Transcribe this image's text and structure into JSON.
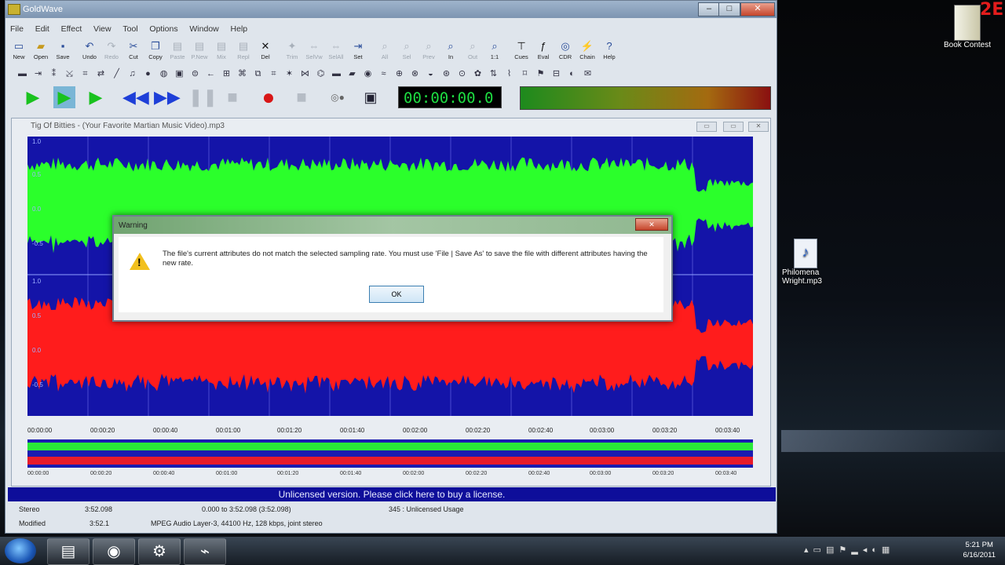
{
  "app": {
    "title": "GoldWave"
  },
  "menu": [
    "File",
    "Edit",
    "Effect",
    "View",
    "Tool",
    "Options",
    "Window",
    "Help"
  ],
  "toolbar1": [
    {
      "label": "New",
      "icon": "new-file-icon",
      "enabled": true
    },
    {
      "label": "Open",
      "icon": "open-folder-icon",
      "enabled": true
    },
    {
      "label": "Save",
      "icon": "save-icon",
      "enabled": true
    },
    {
      "label": "Undo",
      "icon": "undo-icon",
      "enabled": true
    },
    {
      "label": "Redo",
      "icon": "redo-icon",
      "enabled": false
    },
    {
      "label": "Cut",
      "icon": "cut-icon",
      "enabled": true
    },
    {
      "label": "Copy",
      "icon": "copy-icon",
      "enabled": true
    },
    {
      "label": "Paste",
      "icon": "paste-icon",
      "enabled": false
    },
    {
      "label": "P.New",
      "icon": "paste-new-icon",
      "enabled": false
    },
    {
      "label": "Mix",
      "icon": "mix-icon",
      "enabled": false
    },
    {
      "label": "Repl",
      "icon": "replace-icon",
      "enabled": false
    },
    {
      "label": "Del",
      "icon": "delete-icon",
      "enabled": true
    },
    {
      "label": "Trim",
      "icon": "trim-icon",
      "enabled": false
    },
    {
      "label": "SelVw",
      "icon": "select-view-icon",
      "enabled": false
    },
    {
      "label": "SelAll",
      "icon": "select-all-icon",
      "enabled": false
    },
    {
      "label": "Set",
      "icon": "set-marker-icon",
      "enabled": true
    },
    {
      "label": "All",
      "icon": "zoom-all-icon",
      "enabled": false
    },
    {
      "label": "Sel",
      "icon": "zoom-selection-icon",
      "enabled": false
    },
    {
      "label": "Prev",
      "icon": "zoom-previous-icon",
      "enabled": false
    },
    {
      "label": "In",
      "icon": "zoom-in-icon",
      "enabled": true
    },
    {
      "label": "Out",
      "icon": "zoom-out-icon",
      "enabled": false
    },
    {
      "label": "1:1",
      "icon": "zoom-1to1-icon",
      "enabled": true
    },
    {
      "label": "Cues",
      "icon": "cues-icon",
      "enabled": true
    },
    {
      "label": "Eval",
      "icon": "eval-icon",
      "enabled": true
    },
    {
      "label": "CDR",
      "icon": "cd-reader-icon",
      "enabled": true
    },
    {
      "label": "Chain",
      "icon": "chain-icon",
      "enabled": true
    },
    {
      "label": "Help",
      "icon": "help-icon",
      "enabled": true
    }
  ],
  "transport": {
    "time": "00:00:00.0"
  },
  "document": {
    "title": "Tig Of Bitties - (Your Favorite Martian Music Video).mp3"
  },
  "channel_labels": {
    "top": [
      "1.0",
      "0.5",
      "0.0",
      "-0.5"
    ],
    "bottom": [
      "1.0",
      "0.5",
      "0.0",
      "-0.5"
    ]
  },
  "ruler_ticks": [
    "00:00:00",
    "00:00:20",
    "00:00:40",
    "00:01:00",
    "00:01:20",
    "00:01:40",
    "00:02:00",
    "00:02:20",
    "00:02:40",
    "00:03:00",
    "00:03:20",
    "00:03:40"
  ],
  "colors": {
    "left_channel": "#2bff2b",
    "right_channel": "#ff1c1c",
    "wave_bg": "#1414a8"
  },
  "dialog": {
    "title": "Warning",
    "message": "The file's current attributes do not match the selected sampling rate.  You must use 'File | Save As' to save the file with different attributes having the new rate.",
    "ok_label": "OK"
  },
  "banner": "Unlicensed version. Please click here to buy a license.",
  "status": {
    "channels": "Stereo",
    "duration": "3:52.098",
    "selection": "0.000 to 3:52.098 (3:52.098)",
    "usage": "345 : Unlicensed Usage",
    "state": "Modified",
    "position": "3:52.1",
    "format": "MPEG Audio Layer-3, 44100 Hz, 128 kbps, joint stereo"
  },
  "desktop": {
    "book_label": "Book Contest",
    "file_label": "Philomena Wright.mp3",
    "logo": "2E"
  },
  "clock": {
    "time": "5:21 PM",
    "date": "6/16/2011"
  }
}
